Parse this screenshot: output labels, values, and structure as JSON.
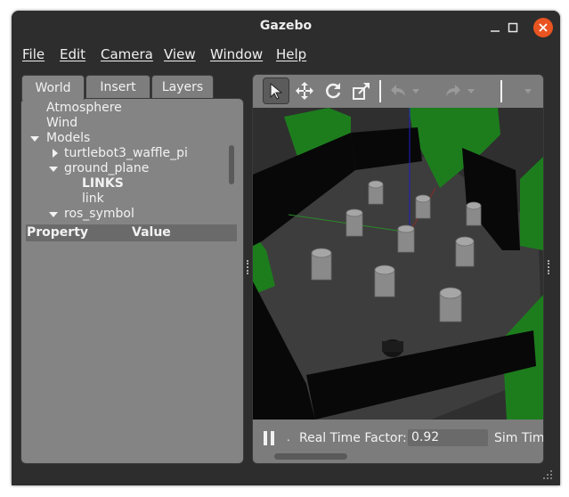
{
  "window": {
    "title": "Gazebo"
  },
  "menubar": {
    "items": [
      "File",
      "Edit",
      "Camera",
      "View",
      "Window",
      "Help"
    ]
  },
  "left_panel": {
    "tabs": [
      "World",
      "Insert",
      "Layers"
    ],
    "active_tab": "World",
    "tree": {
      "atmosphere": "Atmosphere",
      "wind": "Wind",
      "models": "Models",
      "turtlebot": "turtlebot3_waffle_pi",
      "ground_plane": "ground_plane",
      "links": "LINKS",
      "link": "link",
      "ros_symbol": "ros_symbol"
    },
    "property_header": {
      "property": "Property",
      "value": "Value"
    }
  },
  "toolbar": {
    "tools": [
      "select-arrow-icon",
      "translate-icon",
      "rotate-icon",
      "scale-icon",
      "undo-icon",
      "redo-icon"
    ],
    "active_tool": "select-arrow-icon"
  },
  "bottom_bar": {
    "real_time_factor_label": "Real Time Factor:",
    "real_time_factor_value": "0.92",
    "sim_time_label": "Sim Tim"
  },
  "colors": {
    "window_bg": "#2d2d2d",
    "panel_bg": "#848484",
    "close_button": "#e95420",
    "wall": "#000000",
    "tree_green": "#1a7a1a",
    "cylinder": "#8a8a8a",
    "floor": "#3a3a3a"
  }
}
